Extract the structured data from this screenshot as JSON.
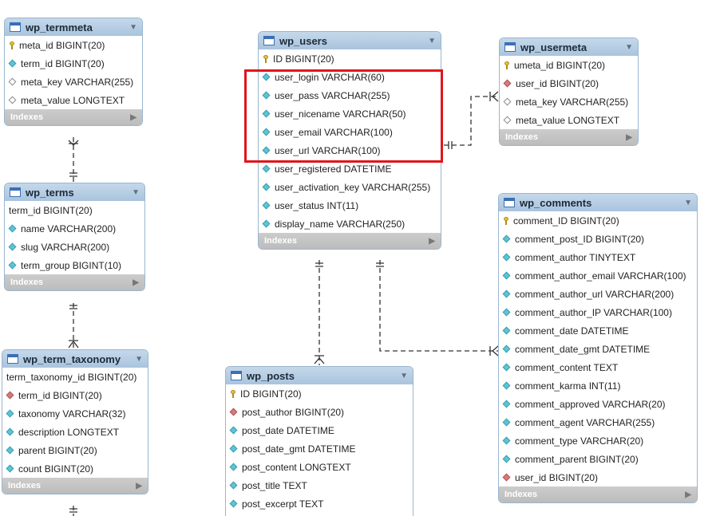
{
  "tables": [
    {
      "id": "wp_termmeta",
      "name": "wp_termmeta",
      "indexes_label": "Indexes",
      "columns": [
        {
          "text": "meta_id BIGINT(20)",
          "icon": "key"
        },
        {
          "text": "term_id BIGINT(20)",
          "icon": "cyan"
        },
        {
          "text": "meta_key VARCHAR(255)",
          "icon": "hollow"
        },
        {
          "text": "meta_value LONGTEXT",
          "icon": "hollow"
        }
      ]
    },
    {
      "id": "wp_terms",
      "name": "wp_terms",
      "indexes_label": "Indexes",
      "columns": [
        {
          "text": "term_id BIGINT(20)",
          "icon": "none"
        },
        {
          "text": "name VARCHAR(200)",
          "icon": "cyan"
        },
        {
          "text": "slug VARCHAR(200)",
          "icon": "cyan"
        },
        {
          "text": "term_group BIGINT(10)",
          "icon": "cyan"
        }
      ]
    },
    {
      "id": "wp_term_taxonomy",
      "name": "wp_term_taxonomy",
      "indexes_label": "Indexes",
      "columns": [
        {
          "text": "term_taxonomy_id BIGINT(20)",
          "icon": "none"
        },
        {
          "text": "term_id BIGINT(20)",
          "icon": "red"
        },
        {
          "text": "taxonomy VARCHAR(32)",
          "icon": "cyan"
        },
        {
          "text": "description LONGTEXT",
          "icon": "cyan"
        },
        {
          "text": "parent BIGINT(20)",
          "icon": "cyan"
        },
        {
          "text": "count BIGINT(20)",
          "icon": "cyan"
        }
      ]
    },
    {
      "id": "wp_users",
      "name": "wp_users",
      "indexes_label": "Indexes",
      "columns": [
        {
          "text": "ID BIGINT(20)",
          "icon": "key"
        },
        {
          "text": "user_login VARCHAR(60)",
          "icon": "cyan"
        },
        {
          "text": "user_pass VARCHAR(255)",
          "icon": "cyan"
        },
        {
          "text": "user_nicename VARCHAR(50)",
          "icon": "cyan"
        },
        {
          "text": "user_email VARCHAR(100)",
          "icon": "cyan"
        },
        {
          "text": "user_url VARCHAR(100)",
          "icon": "cyan"
        },
        {
          "text": "user_registered DATETIME",
          "icon": "cyan"
        },
        {
          "text": "user_activation_key VARCHAR(255)",
          "icon": "cyan"
        },
        {
          "text": "user_status INT(11)",
          "icon": "cyan"
        },
        {
          "text": "display_name VARCHAR(250)",
          "icon": "cyan"
        }
      ]
    },
    {
      "id": "wp_usermeta",
      "name": "wp_usermeta",
      "indexes_label": "Indexes",
      "columns": [
        {
          "text": "umeta_id BIGINT(20)",
          "icon": "key"
        },
        {
          "text": "user_id BIGINT(20)",
          "icon": "red"
        },
        {
          "text": "meta_key VARCHAR(255)",
          "icon": "hollow"
        },
        {
          "text": "meta_value LONGTEXT",
          "icon": "hollow"
        }
      ]
    },
    {
      "id": "wp_comments",
      "name": "wp_comments",
      "indexes_label": "Indexes",
      "columns": [
        {
          "text": "comment_ID BIGINT(20)",
          "icon": "key"
        },
        {
          "text": "comment_post_ID BIGINT(20)",
          "icon": "cyan"
        },
        {
          "text": "comment_author TINYTEXT",
          "icon": "cyan"
        },
        {
          "text": "comment_author_email VARCHAR(100)",
          "icon": "cyan"
        },
        {
          "text": "comment_author_url VARCHAR(200)",
          "icon": "cyan"
        },
        {
          "text": "comment_author_IP VARCHAR(100)",
          "icon": "cyan"
        },
        {
          "text": "comment_date DATETIME",
          "icon": "cyan"
        },
        {
          "text": "comment_date_gmt DATETIME",
          "icon": "cyan"
        },
        {
          "text": "comment_content TEXT",
          "icon": "cyan"
        },
        {
          "text": "comment_karma INT(11)",
          "icon": "cyan"
        },
        {
          "text": "comment_approved VARCHAR(20)",
          "icon": "cyan"
        },
        {
          "text": "comment_agent VARCHAR(255)",
          "icon": "cyan"
        },
        {
          "text": "comment_type VARCHAR(20)",
          "icon": "cyan"
        },
        {
          "text": "comment_parent BIGINT(20)",
          "icon": "cyan"
        },
        {
          "text": "user_id BIGINT(20)",
          "icon": "red"
        }
      ]
    },
    {
      "id": "wp_posts",
      "name": "wp_posts",
      "indexes_label": "",
      "columns": [
        {
          "text": "ID BIGINT(20)",
          "icon": "key"
        },
        {
          "text": "post_author BIGINT(20)",
          "icon": "red"
        },
        {
          "text": "post_date DATETIME",
          "icon": "cyan"
        },
        {
          "text": "post_date_gmt DATETIME",
          "icon": "cyan"
        },
        {
          "text": "post_content LONGTEXT",
          "icon": "cyan"
        },
        {
          "text": "post_title TEXT",
          "icon": "cyan"
        },
        {
          "text": "post_excerpt TEXT",
          "icon": "cyan"
        }
      ]
    }
  ],
  "highlight": {
    "table": "wp_users",
    "columns": [
      "user_login",
      "user_pass",
      "user_nicename",
      "user_email",
      "user_url"
    ],
    "color": "#e0151c"
  },
  "colors": {
    "header": "#b3cce4",
    "link": "#333333",
    "indexes_bar": "#c4c4c4"
  }
}
